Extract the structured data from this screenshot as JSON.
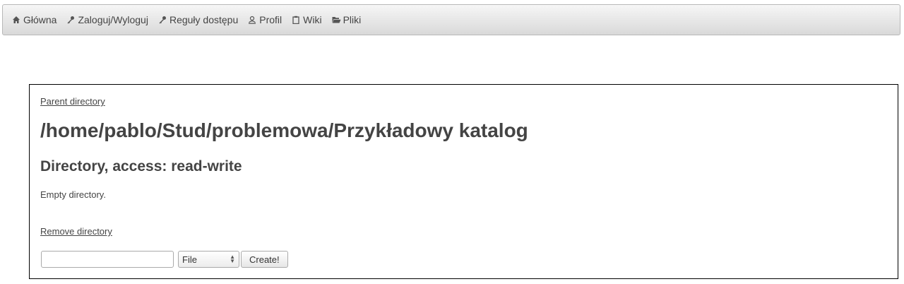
{
  "nav": {
    "items": [
      {
        "label": "Główna",
        "icon": "home-icon"
      },
      {
        "label": "Zaloguj/Wyloguj",
        "icon": "key-icon"
      },
      {
        "label": "Reguły dostępu",
        "icon": "key-icon"
      },
      {
        "label": "Profil",
        "icon": "user-icon"
      },
      {
        "label": "Wiki",
        "icon": "clipboard-icon"
      },
      {
        "label": "Pliki",
        "icon": "folder-open-icon"
      }
    ]
  },
  "directory": {
    "parent_link": "Parent directory",
    "path": "/home/pablo/Stud/problemowa/Przykładowy katalog",
    "heading": "Directory, access: read-write",
    "empty_text": "Empty directory.",
    "remove_link": "Remove directory"
  },
  "create_form": {
    "name_value": "",
    "type_selected": "File",
    "create_label": "Create!"
  }
}
